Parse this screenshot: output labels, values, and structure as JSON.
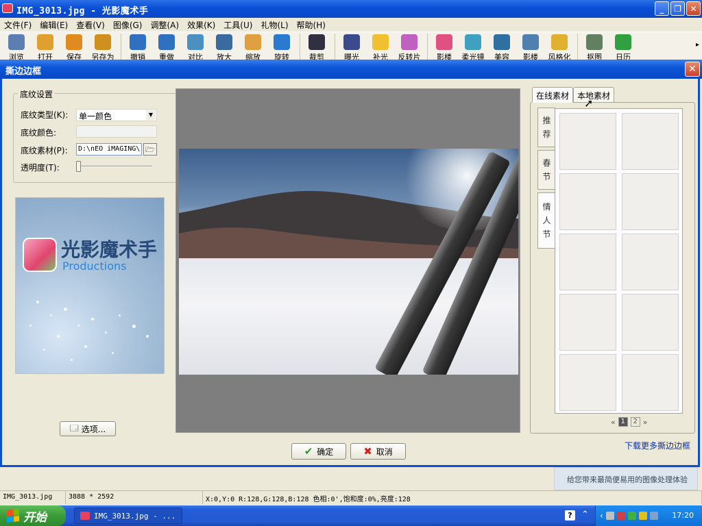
{
  "window": {
    "title": "IMG_3013.jpg - 光影魔术手"
  },
  "menu": [
    "文件(F)",
    "编辑(E)",
    "查看(V)",
    "图像(G)",
    "调整(A)",
    "效果(K)",
    "工具(U)",
    "礼物(L)",
    "帮助(H)"
  ],
  "toolbar": [
    {
      "label": "浏览",
      "icon": "eye-icon",
      "color": "#5a7fb0"
    },
    {
      "label": "打开",
      "icon": "folder-open-icon",
      "color": "#e0a030"
    },
    {
      "label": "保存",
      "icon": "save-icon",
      "color": "#e08a20"
    },
    {
      "label": "另存为",
      "icon": "save-as-icon",
      "color": "#d09020"
    },
    {
      "label": "撤销",
      "icon": "undo-icon",
      "color": "#3070c0"
    },
    {
      "label": "重做",
      "icon": "redo-icon",
      "color": "#3070c0"
    },
    {
      "label": "对比",
      "icon": "compare-icon",
      "color": "#4a90c0"
    },
    {
      "label": "放大",
      "icon": "zoom-in-icon",
      "color": "#3a6aa0"
    },
    {
      "label": "缩放",
      "icon": "resize-icon",
      "color": "#e0a040"
    },
    {
      "label": "旋转",
      "icon": "rotate-icon",
      "color": "#2a7ad0"
    },
    {
      "label": "裁剪",
      "icon": "crop-icon",
      "color": "#303040"
    },
    {
      "label": "曝光",
      "icon": "exposure-icon",
      "color": "#3a4a8a"
    },
    {
      "label": "补光",
      "icon": "fill-light-icon",
      "color": "#f0c030"
    },
    {
      "label": "反转片",
      "icon": "reversal-film-icon",
      "color": "#c060c0"
    },
    {
      "label": "影楼",
      "icon": "color-wheel-icon",
      "color": "#e05080"
    },
    {
      "label": "柔光镜",
      "icon": "soft-light-icon",
      "color": "#40a0c0"
    },
    {
      "label": "美容",
      "icon": "beauty-face-icon",
      "color": "#3070a0"
    },
    {
      "label": "影楼",
      "icon": "studio-icon",
      "color": "#5080b0"
    },
    {
      "label": "风格化",
      "icon": "stylize-icon",
      "color": "#e0b030"
    },
    {
      "label": "抠图",
      "icon": "cutout-icon",
      "color": "#608060"
    },
    {
      "label": "日历",
      "icon": "calendar-icon",
      "color": "#30a040"
    }
  ],
  "dialog": {
    "title": "撕边边框",
    "texture_settings": {
      "legend": "底纹设置",
      "type_label": "底纹类型(K):",
      "type_value": "单一颜色",
      "color_label": "底纹颜色:",
      "material_label": "底纹素材(P):",
      "material_path": "D:\\nEO iMAGING\\",
      "opacity_label": "透明度(T):",
      "opacity_value": 0
    },
    "logo": {
      "cn": "光影魔术手",
      "en": "Productions"
    },
    "options_button": "选项...",
    "ok_button": "确定",
    "cancel_button": "取消",
    "tabs": [
      "在线素材",
      "本地素材"
    ],
    "active_tab": 0,
    "categories": [
      "推荐",
      "春节",
      "情人节"
    ],
    "active_category": 2,
    "thumb_count": 10,
    "pager": {
      "prev": "«",
      "pages": [
        "1",
        "2"
      ],
      "current": "1",
      "next": "»"
    },
    "download_link": "下载更多撕边边框"
  },
  "promo_text": "给您带来最简便易用的图像处理体验",
  "status": {
    "filename": "IMG_3013.jpg",
    "dimensions": "3888 * 2592",
    "pixel_info": "X:0,Y:0 R:128,G:128,B:128 色相:0',饱和度:0%,亮度:128"
  },
  "taskbar": {
    "start": "开始",
    "task_label": "IMG_3013.jpg - ...",
    "clock": "17:20"
  },
  "colors": {
    "title_blue": "#0a4fd6",
    "link_blue": "#0030c0"
  }
}
